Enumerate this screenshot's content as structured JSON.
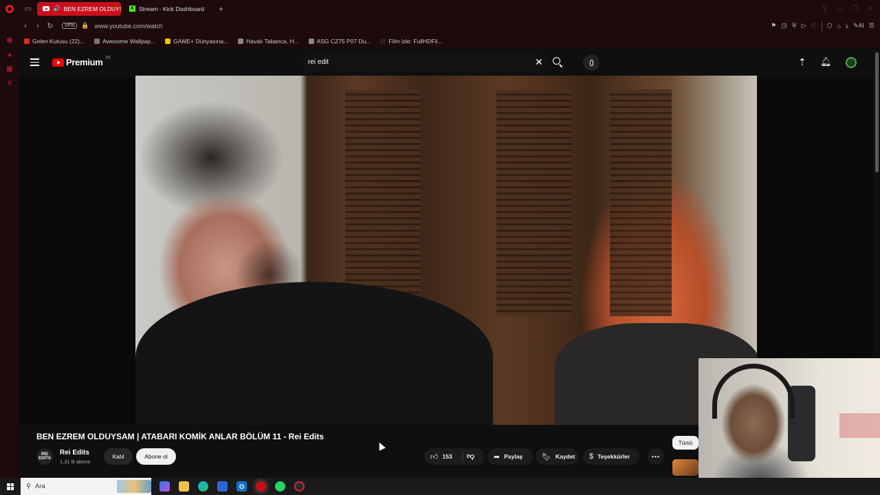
{
  "browser": {
    "tabs": [
      {
        "label": "BEN EZREM OLDUYSA",
        "active": true
      },
      {
        "label": "Stream - Kick Dashboard",
        "active": false
      }
    ],
    "url": "www.youtube.com/watch",
    "vpn_label": "VPN",
    "bookmarks": [
      {
        "label": "Gelen Kutusu (22)...",
        "color": "#d93025"
      },
      {
        "label": "Awesome Wallpap...",
        "color": "#777777"
      },
      {
        "label": "GAME+ Dünyasına...",
        "color": "#f2c200"
      },
      {
        "label": "Havalı Tabanca, H...",
        "color": "#888888"
      },
      {
        "label": "ASG CZ75 P07 Du...",
        "color": "#888888"
      },
      {
        "label": "Film izle: FullHDFil...",
        "color": "#222222"
      }
    ]
  },
  "youtube": {
    "logo_text": "Premium",
    "logo_region": "TR",
    "search_value": "rei edit",
    "video": {
      "title": "BEN EZREM OLDUYSAM | ATABARI KOMİK ANLAR BÖLÜM 11 - Rei Edits",
      "channel_name": "Rei Edits",
      "channel_avatar_text": "REI EDITS",
      "subscribers": "1,31 B abone",
      "join_label": "Katıl",
      "subscribe_label": "Abone ol",
      "likes": "153",
      "share_label": "Paylaş",
      "save_label": "Kaydet",
      "thanks_label": "Teşekkürler",
      "more_label": "•••"
    },
    "chip_label": "Tümü"
  },
  "taskbar": {
    "search_placeholder": "Ara"
  },
  "colors": {
    "accent": "#c8101c",
    "youtube_red": "#ff0000",
    "background": "#0f0f0f"
  }
}
